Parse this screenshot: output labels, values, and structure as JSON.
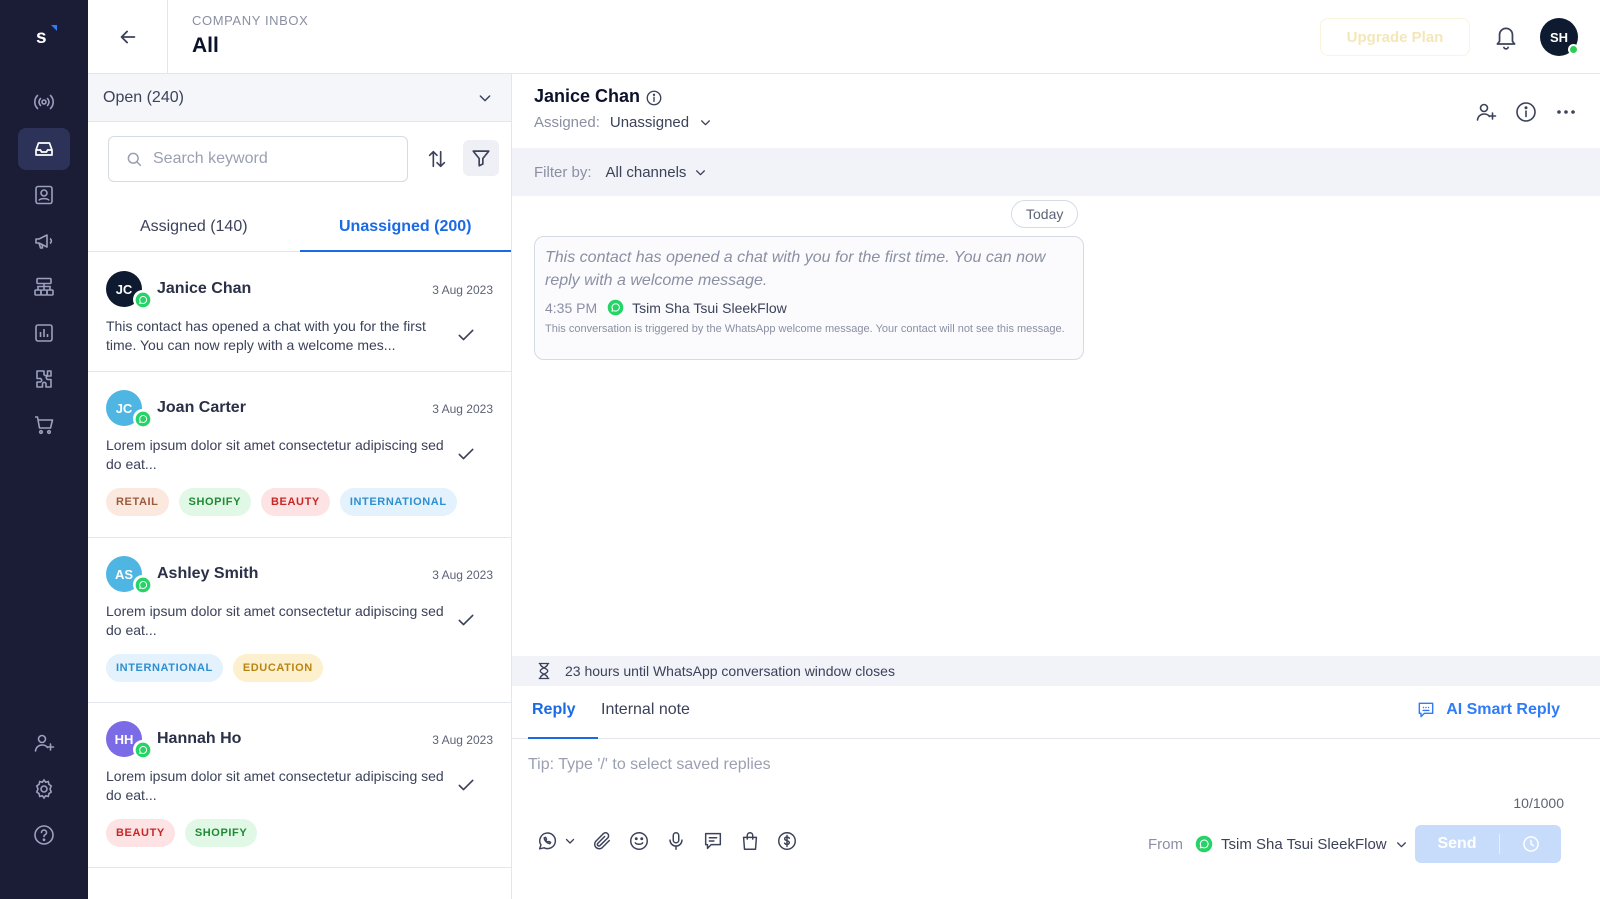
{
  "app": {
    "logo_letter": "s"
  },
  "rail": {
    "items": [
      "broadcast-icon",
      "inbox-icon",
      "contacts-icon",
      "campaigns-icon",
      "flow-builder-icon",
      "analytics-icon",
      "integrations-icon",
      "commerce-icon",
      "invite-user-icon",
      "settings-icon",
      "help-icon"
    ],
    "active": "inbox-icon"
  },
  "header": {
    "subtitle": "COMPANY INBOX",
    "title": "All",
    "upgrade_label": "Upgrade Plan",
    "user_initials": "SH"
  },
  "list": {
    "status_filter": "Open (240)",
    "search_placeholder": "Search keyword",
    "tabs": [
      {
        "label": "Assigned (140)",
        "active": false
      },
      {
        "label": "Unassigned (200)",
        "active": true
      }
    ],
    "conversations": [
      {
        "initials": "JC",
        "name": "Janice Chan",
        "date": "3 Aug 2023",
        "message": "This contact has opened a chat with you for the first time. You can now reply with a welcome mes...",
        "avatar_color": "#0e1a2f",
        "tags": []
      },
      {
        "initials": "JC",
        "name": "Joan Carter",
        "date": "3 Aug 2023",
        "message": "Lorem ipsum dolor sit amet consectetur adipiscing sed do eat...",
        "avatar_color": "#4fb6e3",
        "tags": [
          "RETAIL",
          "SHOPIFY",
          "BEAUTY",
          "INTERNATIONAL"
        ]
      },
      {
        "initials": "AS",
        "name": "Ashley Smith",
        "date": "3 Aug 2023",
        "message": "Lorem ipsum dolor sit amet consectetur adipiscing sed do eat...",
        "avatar_color": "#4fb6e3",
        "tags": [
          "INTERNATIONAL",
          "EDUCATION"
        ]
      },
      {
        "initials": "HH",
        "name": "Hannah Ho",
        "date": "3 Aug 2023",
        "message": "Lorem ipsum dolor sit amet consectetur adipiscing sed do eat...",
        "avatar_color": "#7b6be6",
        "tags": [
          "BEAUTY",
          "SHOPIFY"
        ]
      }
    ]
  },
  "tag_colors": {
    "RETAIL": {
      "bg": "#fbe9e0",
      "fg": "#9a5a3c"
    },
    "SHOPIFY": {
      "bg": "#e2f8e6",
      "fg": "#1f8a34"
    },
    "BEAUTY": {
      "bg": "#fde3e3",
      "fg": "#c62828"
    },
    "INTERNATIONAL": {
      "bg": "#e3f2fc",
      "fg": "#2d8fd0"
    },
    "EDUCATION": {
      "bg": "#fdf0cf",
      "fg": "#b98512"
    }
  },
  "chat": {
    "contact_name": "Janice Chan",
    "assigned_label": "Assigned:",
    "assigned_value": "Unassigned",
    "filter_label": "Filter by:",
    "filter_value": "All channels",
    "date_divider": "Today",
    "system_message": "This contact has opened a chat with you for the first time. You can now reply with a welcome message.",
    "message_time": "4:35 PM",
    "message_channel": "Tsim Sha Tsui SleekFlow",
    "message_note": "This conversation is triggered by the WhatsApp welcome message. Your contact will not see this message.",
    "window_notice": "23 hours until WhatsApp conversation window closes"
  },
  "composer": {
    "tabs": [
      {
        "label": "Reply",
        "active": true
      },
      {
        "label": "Internal note",
        "active": false
      }
    ],
    "ai_reply_label": "AI Smart Reply",
    "placeholder": "Tip: Type '/' to select saved replies",
    "counter": "10/1000",
    "tools": [
      "whatsapp-channel-icon",
      "attachment-icon",
      "emoji-icon",
      "microphone-icon",
      "template-icon",
      "product-icon",
      "payment-icon"
    ],
    "from_label": "From",
    "from_value": "Tsim Sha Tsui SleekFlow",
    "send_label": "Send"
  },
  "colors": {
    "accent": "#1a6ae6",
    "rail_bg": "#1b1c36",
    "whatsapp": "#25d366"
  }
}
